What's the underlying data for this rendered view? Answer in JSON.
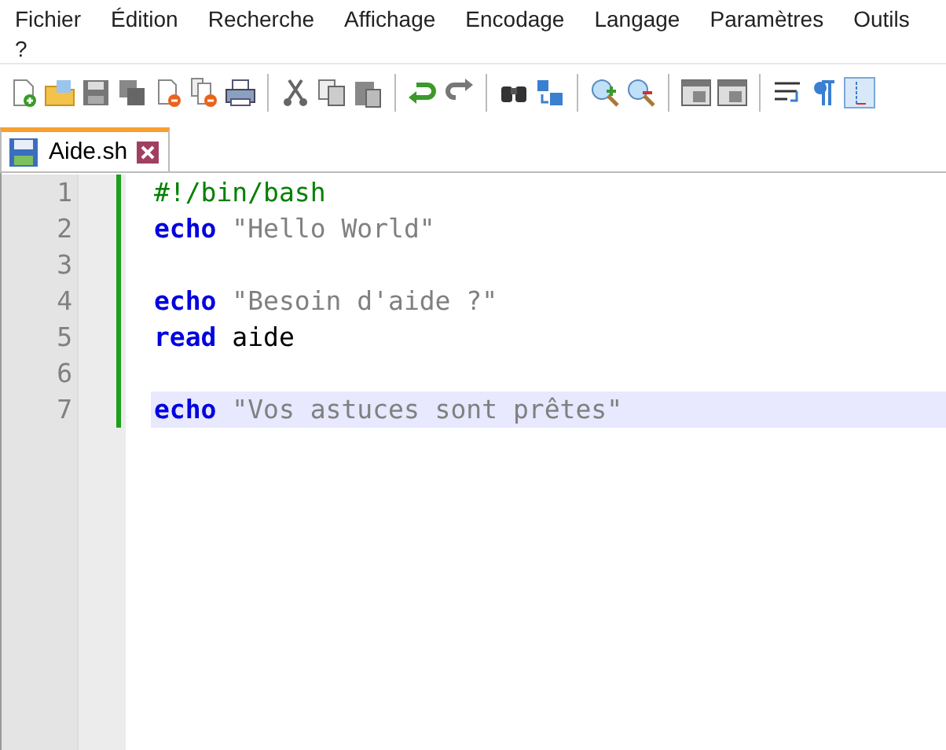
{
  "menu": [
    "Fichier",
    "Édition",
    "Recherche",
    "Affichage",
    "Encodage",
    "Langage",
    "Paramètres",
    "Outils",
    "?"
  ],
  "tabs": [
    {
      "label": "Aide.sh",
      "selected": true
    }
  ],
  "editor": {
    "lines": [
      {
        "number": "1",
        "current": false,
        "tokens": [
          {
            "kind": "comment",
            "text": "#!/bin/bash"
          }
        ]
      },
      {
        "number": "2",
        "current": false,
        "tokens": [
          {
            "kind": "keyword",
            "text": "echo"
          },
          {
            "kind": "string",
            "text": "\"Hello World\""
          }
        ]
      },
      {
        "number": "3",
        "current": false
      },
      {
        "number": "4",
        "current": false,
        "tokens": [
          {
            "kind": "keyword",
            "text": "echo"
          },
          {
            "kind": "string",
            "text": "\"Besoin d'aide ?\""
          }
        ]
      },
      {
        "number": "5",
        "current": false,
        "tokens": [
          {
            "kind": "keyword",
            "text": "read"
          },
          {
            "kind": "plain",
            "text": "aide"
          }
        ]
      },
      {
        "number": "6",
        "current": false
      },
      {
        "number": "7",
        "current": true,
        "tokens": [
          {
            "kind": "keyword",
            "text": "echo"
          },
          {
            "kind": "string",
            "text": "\"Vos astuces sont prêtes\""
          }
        ]
      }
    ]
  }
}
